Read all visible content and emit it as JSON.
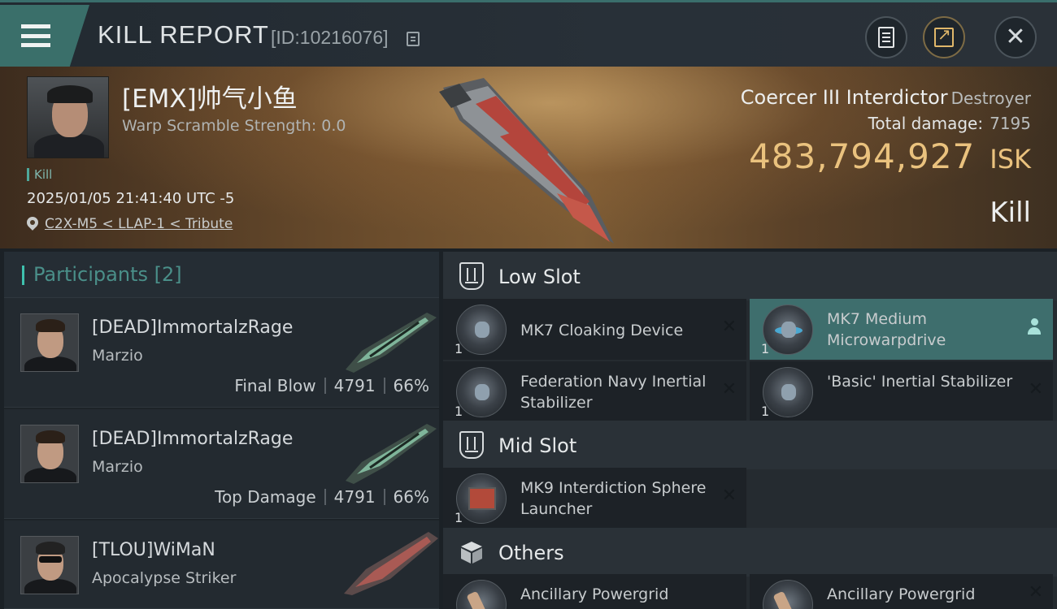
{
  "header": {
    "title": "KILL REPORT",
    "id_label": "[ID:10216076]"
  },
  "victim": {
    "name": "[EMX]帅气小鱼",
    "warp_scramble": "Warp Scramble Strength: 0.0",
    "tag": "Kill",
    "time": "2025/01/05 21:41:40 UTC -5",
    "location": "C2X-M5 < LLAP-1 < Tribute"
  },
  "ship": {
    "name": "Coercer III Interdictor",
    "class": "Destroyer",
    "total_damage_label": "Total damage:",
    "total_damage_value": "7195",
    "isk_value": "483,794,927",
    "isk_unit": "ISK",
    "result": "Kill"
  },
  "participants": {
    "title": "Participants",
    "count": "[2]",
    "items": [
      {
        "name": "[DEAD]ImmortalzRage",
        "ship": "Marzio",
        "role": "Final Blow",
        "damage": "4791",
        "percent": "66%"
      },
      {
        "name": "[DEAD]ImmortalzRage",
        "ship": "Marzio",
        "role": "Top Damage",
        "damage": "4791",
        "percent": "66%"
      },
      {
        "name": "[TLOU]WiMaN",
        "ship": "Apocalypse Striker"
      }
    ]
  },
  "fitting": {
    "low_slot": {
      "title": "Low Slot",
      "modules": [
        {
          "name": "MK7 Cloaking Device",
          "qty": "1"
        },
        {
          "name": "MK7 Medium Microwarpdrive",
          "qty": "1"
        },
        {
          "name": "Federation Navy Inertial Stabilizer",
          "qty": "1"
        },
        {
          "name": "'Basic' Inertial Stabilizer",
          "qty": "1"
        }
      ]
    },
    "mid_slot": {
      "title": "Mid Slot",
      "modules": [
        {
          "name": "MK9 Interdiction Sphere Launcher",
          "qty": "1"
        }
      ]
    },
    "others": {
      "title": "Others",
      "modules": [
        {
          "name": "Ancillary Powergrid"
        },
        {
          "name": "Ancillary Powergrid"
        }
      ]
    }
  },
  "icons": {
    "menu": "hamburger-icon",
    "copy": "copy-icon",
    "report": "clipboard-icon",
    "share": "share-icon",
    "close": "close-icon",
    "location": "pin-icon",
    "slot": "slot-shield-icon",
    "others": "cube-icon",
    "remove": "x-icon",
    "owner": "person-icon"
  },
  "colors": {
    "accent": "#3ec1ae",
    "isk": "#eac27e",
    "menu_bg": "#3a6f6a",
    "active_module": "#3e6e6d"
  }
}
